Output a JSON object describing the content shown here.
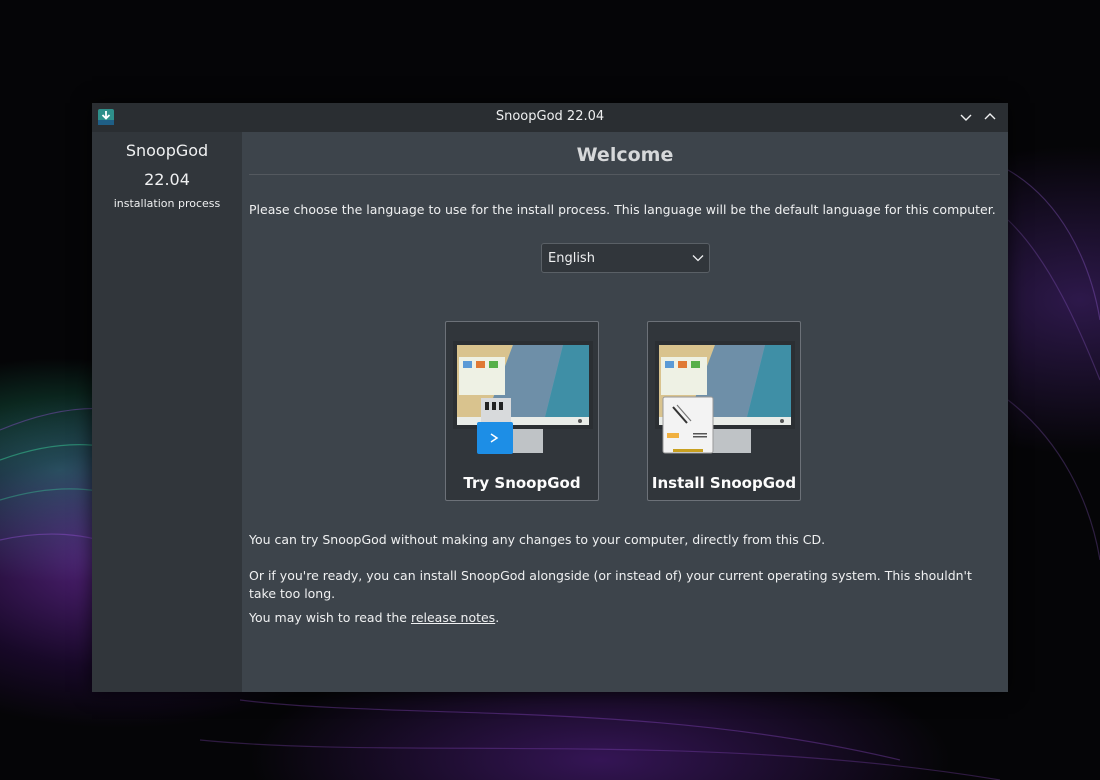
{
  "window": {
    "title": "SnoopGod 22.04",
    "icon": "installer-download-icon",
    "buttons": [
      "minimize-icon",
      "maximize-icon"
    ]
  },
  "sidebar": {
    "product": "SnoopGod",
    "version": "22.04",
    "subtitle": "installation process"
  },
  "main": {
    "heading": "Welcome",
    "intro": "Please choose the language to use for the install process. This language will be the default language for this computer.",
    "language_selected": "English",
    "options": [
      {
        "label": "Try SnoopGod",
        "icon": "usb-live-icon"
      },
      {
        "label": "Install SnoopGod",
        "icon": "disk-install-icon"
      }
    ],
    "try_text": "You can try SnoopGod without making any changes to your computer, directly from this CD.",
    "install_text": "Or if you're ready, you can install SnoopGod alongside (or instead of) your current operating system.  This shouldn't take too long.",
    "notes_prefix": "You may wish to read the ",
    "notes_link": "release notes",
    "notes_suffix": "."
  },
  "colors": {
    "window_bg": "#31363b",
    "content_bg": "#3d444b",
    "titlebar_bg": "#2a2e32",
    "text": "#eff0f1"
  }
}
